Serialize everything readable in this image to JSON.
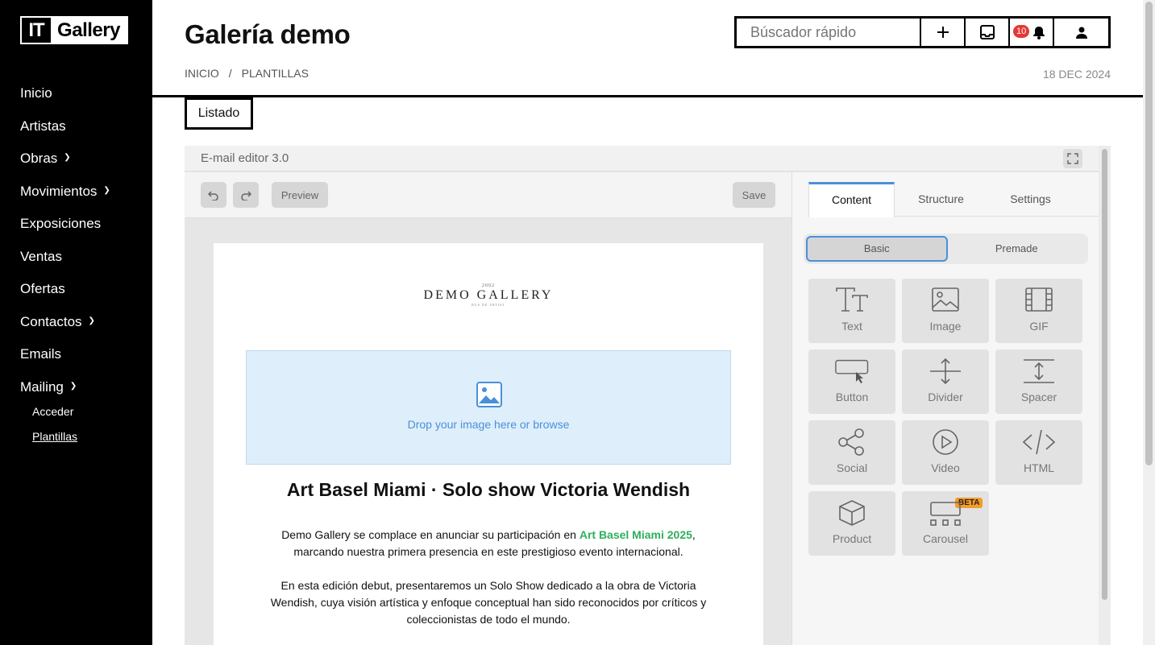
{
  "logo": {
    "it": "IT",
    "gallery": "Gallery"
  },
  "sidebar": {
    "items": [
      {
        "label": "Inicio"
      },
      {
        "label": "Artistas"
      },
      {
        "label": "Obras"
      },
      {
        "label": "Movimientos"
      },
      {
        "label": "Exposiciones"
      },
      {
        "label": "Ventas"
      },
      {
        "label": "Ofertas"
      },
      {
        "label": "Contactos"
      },
      {
        "label": "Emails"
      },
      {
        "label": "Mailing"
      }
    ],
    "subitems": [
      {
        "label": "Acceder"
      },
      {
        "label": "Plantillas"
      }
    ]
  },
  "header": {
    "title": "Galería demo",
    "breadcrumb": {
      "home": "INICIO",
      "sep": "/",
      "current": "PLANTILLAS"
    },
    "date": "18 DEC 2024",
    "search_placeholder": "Búscador rápido",
    "notifications_count": "10"
  },
  "tabs": {
    "listado": "Listado"
  },
  "editor": {
    "title": "E-mail editor 3.0",
    "preview_label": "Preview",
    "save_label": "Save"
  },
  "email": {
    "brand_year": "2002",
    "brand_name": "DEMO GALLERY",
    "brand_tag": "BUS DE ARTIST",
    "dropzone_text": "Drop your image here or browse",
    "title": "Art Basel Miami · Solo show Victoria Wendish",
    "p1_before": "Demo Gallery se complace en anunciar su participación en ",
    "p1_highlight": "Art Basel Miami 2025",
    "p1_after": ", marcando nuestra primera presencia en este prestigioso evento internacional.",
    "p2": "En esta edición debut, presentaremos un Solo Show dedicado a la obra de Victoria Wendish, cuya visión artística y enfoque conceptual han sido reconocidos por críticos y coleccionistas de todo el mundo."
  },
  "panel": {
    "tabs": [
      "Content",
      "Structure",
      "Settings"
    ],
    "segments": [
      "Basic",
      "Premade"
    ],
    "blocks": [
      {
        "label": "Text",
        "icon": "text-icon"
      },
      {
        "label": "Image",
        "icon": "image-icon"
      },
      {
        "label": "GIF",
        "icon": "gif-icon"
      },
      {
        "label": "Button",
        "icon": "button-icon"
      },
      {
        "label": "Divider",
        "icon": "divider-icon"
      },
      {
        "label": "Spacer",
        "icon": "spacer-icon"
      },
      {
        "label": "Social",
        "icon": "social-icon"
      },
      {
        "label": "Video",
        "icon": "video-icon"
      },
      {
        "label": "HTML",
        "icon": "html-icon"
      },
      {
        "label": "Product",
        "icon": "product-icon"
      },
      {
        "label": "Carousel",
        "icon": "carousel-icon"
      }
    ],
    "beta_label": "BETA"
  },
  "colors": {
    "accent": "#4a90d9",
    "highlight": "#2eaf5c",
    "badge": "#e53935",
    "beta": "#f59b27"
  }
}
